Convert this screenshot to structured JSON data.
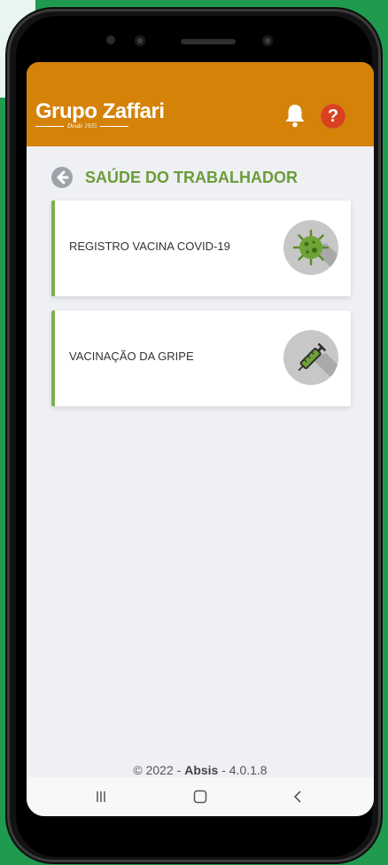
{
  "header": {
    "logo_text": "Grupo Zaffari",
    "logo_since": "Desde 1935"
  },
  "section": {
    "title": "SAÚDE DO TRABALHADOR"
  },
  "cards": [
    {
      "label": "REGISTRO VACINA COVID-19",
      "icon": "virus-icon"
    },
    {
      "label": "VACINAÇÃO  DA GRIPE",
      "icon": "syringe-icon"
    }
  ],
  "footer": {
    "prefix": "© 2022 - ",
    "brand": "Absis",
    "suffix": " - 4.0.1.8"
  },
  "colors": {
    "header": "#d48208",
    "accent_green": "#6c9c3a",
    "help_red": "#d9411f"
  }
}
